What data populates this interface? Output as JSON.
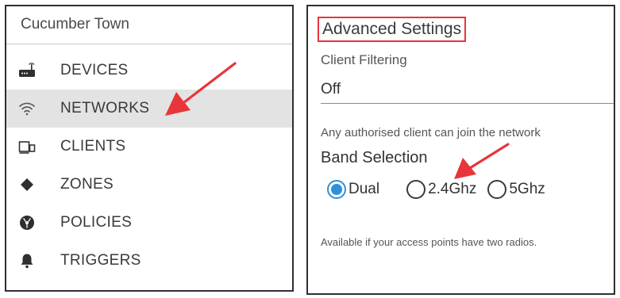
{
  "sidebar": {
    "org_name": "Cucumber Town",
    "items": [
      {
        "label": "DEVICES",
        "icon": "router-icon",
        "active": false
      },
      {
        "label": "NETWORKS",
        "icon": "wifi-icon",
        "active": true
      },
      {
        "label": "CLIENTS",
        "icon": "clients-icon",
        "active": false
      },
      {
        "label": "ZONES",
        "icon": "diamond-icon",
        "active": false
      },
      {
        "label": "POLICIES",
        "icon": "radiation-icon",
        "active": false
      },
      {
        "label": "TRIGGERS",
        "icon": "bell-icon",
        "active": false
      }
    ]
  },
  "settings": {
    "section_title": "Advanced Settings",
    "client_filtering": {
      "label": "Client Filtering",
      "value": "Off",
      "help": "Any authorised client can join the network"
    },
    "band_selection": {
      "label": "Band Selection",
      "options": [
        {
          "label": "Dual",
          "selected": true
        },
        {
          "label": "2.4Ghz",
          "selected": false
        },
        {
          "label": "5Ghz",
          "selected": false
        }
      ],
      "help": "Available if your access points have two radios."
    }
  },
  "colors": {
    "accent_blue": "#2f8fd8",
    "annotation_red": "#e8343b",
    "active_row_bg": "#e3e3e3",
    "border": "#2f2f2f"
  },
  "annotations": [
    "red-arrow-to-networks",
    "red-arrow-to-2.4ghz"
  ]
}
